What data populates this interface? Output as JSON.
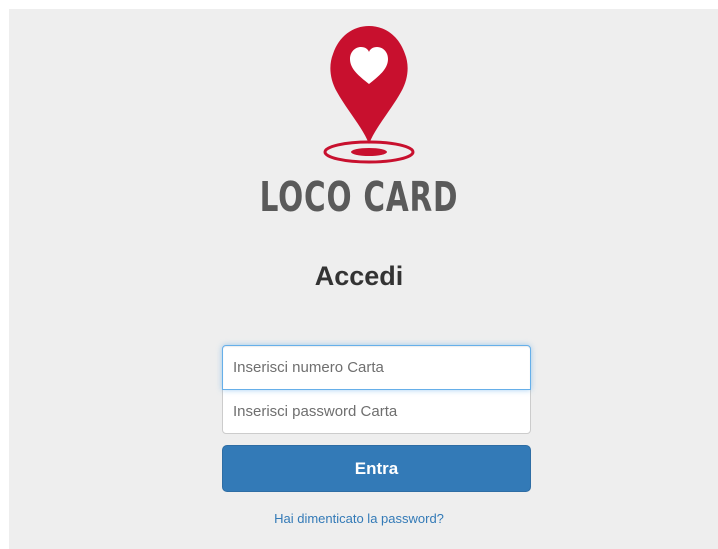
{
  "logo": {
    "text": "LOCO CARD",
    "icon": "map-pin-heart-icon",
    "brand_color": "#c8102e",
    "text_color": "#5a5a5a"
  },
  "page": {
    "title": "Accedi",
    "background": "#eeeeee"
  },
  "form": {
    "card_number": {
      "value": "",
      "placeholder": "Inserisci numero Carta"
    },
    "password": {
      "value": "",
      "placeholder": "Inserisci password Carta"
    },
    "submit_label": "Entra",
    "submit_color": "#337ab7"
  },
  "links": {
    "forgot_password": "Hai dimenticato la password?"
  }
}
